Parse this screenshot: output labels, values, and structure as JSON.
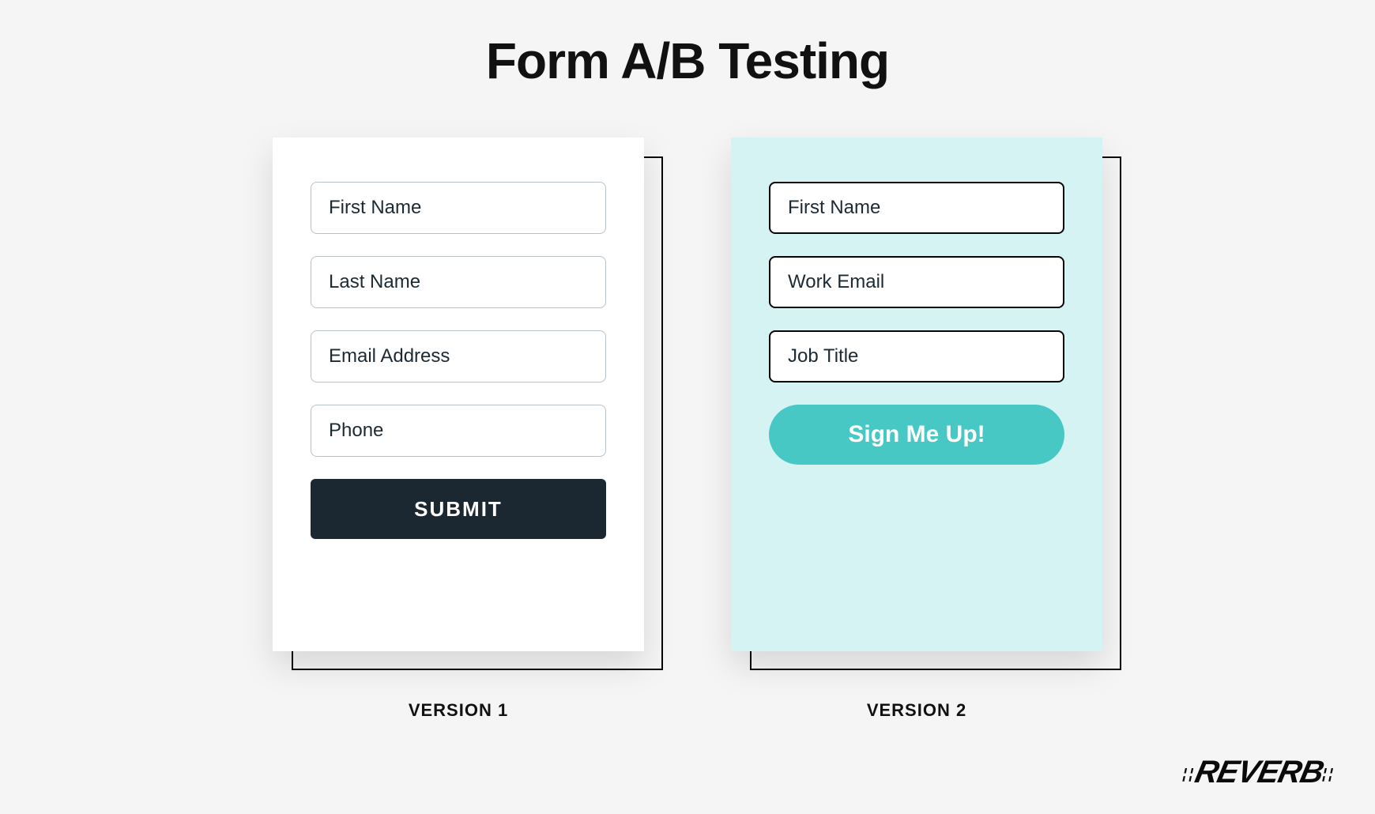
{
  "title": "Form A/B Testing",
  "versionA": {
    "caption": "VERSION 1",
    "fields": [
      {
        "placeholder": "First Name"
      },
      {
        "placeholder": "Last Name"
      },
      {
        "placeholder": "Email Address"
      },
      {
        "placeholder": "Phone"
      }
    ],
    "button_label": "SUBMIT"
  },
  "versionB": {
    "caption": "VERSION 2",
    "fields": [
      {
        "placeholder": "First Name"
      },
      {
        "placeholder": "Work Email"
      },
      {
        "placeholder": "Job Title"
      }
    ],
    "button_label": "Sign Me Up!"
  },
  "brand": "REVERB",
  "colors": {
    "page_bg": "#f5f5f6",
    "card_a_bg": "#ffffff",
    "card_b_bg": "#d6f3f4",
    "btn_a_bg": "#1b2731",
    "btn_b_bg": "#48c8c4",
    "field_a_border": "#b9c2c8",
    "field_b_border": "#050505"
  }
}
